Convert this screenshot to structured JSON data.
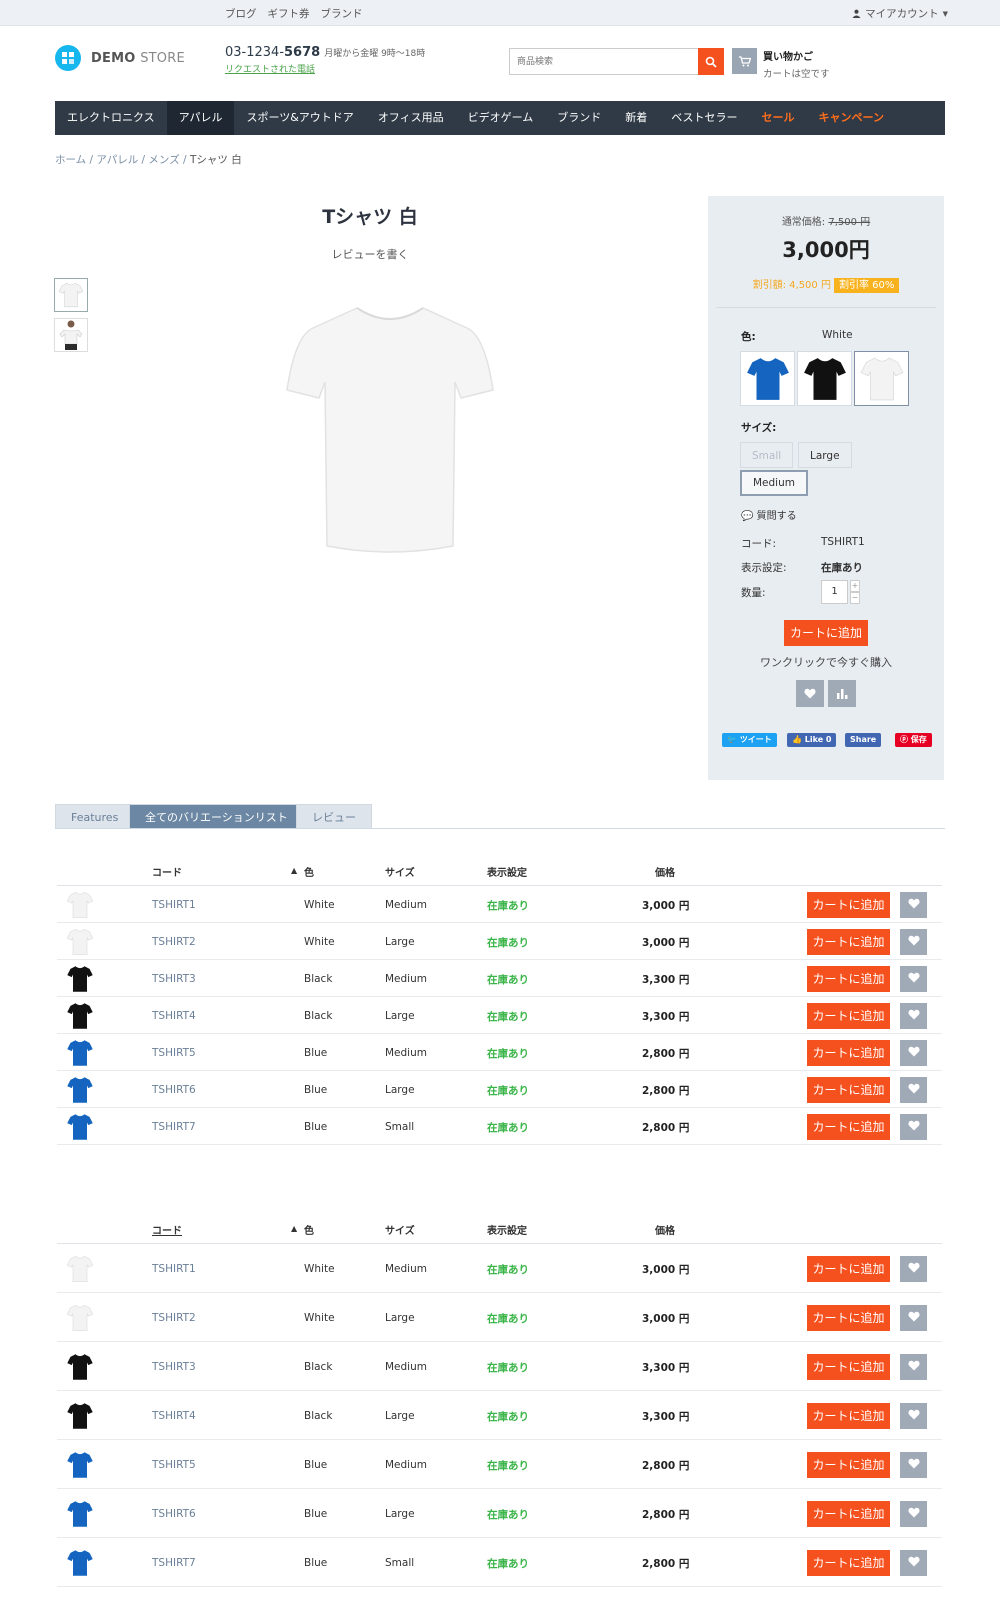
{
  "topbar": {
    "links": [
      "ブログ",
      "ギフト券",
      "ブランド"
    ],
    "account": "マイアカウント"
  },
  "header": {
    "logo_bold": "DEMO",
    "logo_thin": "STORE",
    "phone_prefix": "03-1234-",
    "phone_main": "5678",
    "hours": "月曜から金曜 9時〜18時",
    "callback": "リクエストされた電話",
    "search_placeholder": "商品検索",
    "cart_title": "買い物かご",
    "cart_status": "カートは空です"
  },
  "nav": [
    {
      "label": "エレクトロニクス"
    },
    {
      "label": "アパレル"
    },
    {
      "label": "スポーツ&アウトドア"
    },
    {
      "label": "オフィス用品"
    },
    {
      "label": "ビデオゲーム"
    },
    {
      "label": "ブランド"
    },
    {
      "label": "新着"
    },
    {
      "label": "ベストセラー"
    },
    {
      "label": "セール"
    },
    {
      "label": "キャンペーン"
    }
  ],
  "breadcrumb": [
    "ホーム",
    "アパレル",
    "メンズ",
    "Tシャツ 白"
  ],
  "product": {
    "title": "Tシャツ 白",
    "write_review": "レビューを書く",
    "regular_label": "通常価格:",
    "regular_price": "7,500 円",
    "price": "3,000円",
    "discount_text": "割引額: 4,500 円",
    "discount_pct": "割引率 60%",
    "color_label": "色:",
    "color_value": "White",
    "size_label": "サイズ:",
    "sizes": [
      "Small",
      "Large",
      "Medium"
    ],
    "ask": "質問する",
    "code_label": "コード:",
    "code_value": "TSHIRT1",
    "availability_label": "表示設定:",
    "availability_value": "在庫あり",
    "qty_label": "数量:",
    "qty_value": "1",
    "add_to_cart": "カートに追加",
    "one_click": "ワンクリックで今すぐ購入",
    "social": [
      "ツイート",
      "Like 0",
      "Share",
      "保存"
    ]
  },
  "colors": {
    "accent": "#f4511e",
    "nav": "#2f3a46",
    "instock": "#3bb54a",
    "shirt_blue": "#1565c0",
    "shirt_black": "#111111",
    "shirt_white": "#f3f3f3"
  },
  "tabs": [
    "Features",
    "全てのバリエーションリスト",
    "レビュー"
  ],
  "table": {
    "headers": {
      "code": "コード",
      "color": "色",
      "size": "サイズ",
      "availability": "表示設定",
      "price": "価格"
    },
    "rows": [
      {
        "code": "TSHIRT1",
        "color": "White",
        "size": "Medium",
        "availability": "在庫あり",
        "price": "3,000 円",
        "add": "カートに追加",
        "shirt": "white"
      },
      {
        "code": "TSHIRT2",
        "color": "White",
        "size": "Large",
        "availability": "在庫あり",
        "price": "3,000 円",
        "add": "カートに追加",
        "shirt": "white"
      },
      {
        "code": "TSHIRT3",
        "color": "Black",
        "size": "Medium",
        "availability": "在庫あり",
        "price": "3,300 円",
        "add": "カートに追加",
        "shirt": "black"
      },
      {
        "code": "TSHIRT4",
        "color": "Black",
        "size": "Large",
        "availability": "在庫あり",
        "price": "3,300 円",
        "add": "カートに追加",
        "shirt": "black"
      },
      {
        "code": "TSHIRT5",
        "color": "Blue",
        "size": "Medium",
        "availability": "在庫あり",
        "price": "2,800 円",
        "add": "カートに追加",
        "shirt": "blue"
      },
      {
        "code": "TSHIRT6",
        "color": "Blue",
        "size": "Large",
        "availability": "在庫あり",
        "price": "2,800 円",
        "add": "カートに追加",
        "shirt": "blue"
      },
      {
        "code": "TSHIRT7",
        "color": "Blue",
        "size": "Small",
        "availability": "在庫あり",
        "price": "2,800 円",
        "add": "カートに追加",
        "shirt": "blue"
      }
    ]
  }
}
